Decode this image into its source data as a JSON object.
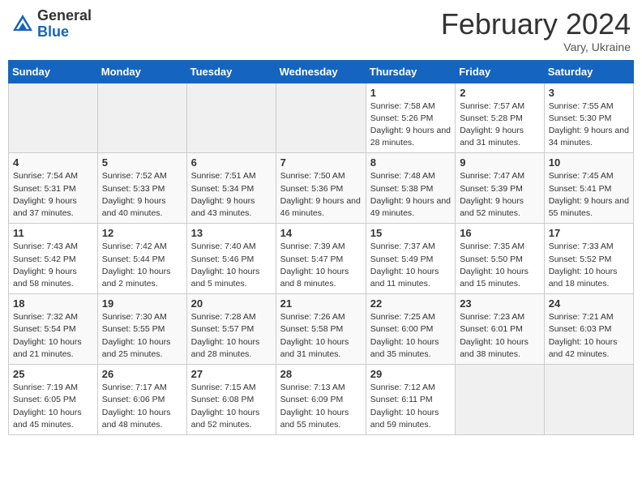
{
  "header": {
    "logo_general": "General",
    "logo_blue": "Blue",
    "title": "February 2024",
    "location": "Vary, Ukraine"
  },
  "columns": [
    "Sunday",
    "Monday",
    "Tuesday",
    "Wednesday",
    "Thursday",
    "Friday",
    "Saturday"
  ],
  "weeks": [
    [
      {
        "day": "",
        "info": ""
      },
      {
        "day": "",
        "info": ""
      },
      {
        "day": "",
        "info": ""
      },
      {
        "day": "",
        "info": ""
      },
      {
        "day": "1",
        "info": "Sunrise: 7:58 AM\nSunset: 5:26 PM\nDaylight: 9 hours\nand 28 minutes."
      },
      {
        "day": "2",
        "info": "Sunrise: 7:57 AM\nSunset: 5:28 PM\nDaylight: 9 hours\nand 31 minutes."
      },
      {
        "day": "3",
        "info": "Sunrise: 7:55 AM\nSunset: 5:30 PM\nDaylight: 9 hours\nand 34 minutes."
      }
    ],
    [
      {
        "day": "4",
        "info": "Sunrise: 7:54 AM\nSunset: 5:31 PM\nDaylight: 9 hours\nand 37 minutes."
      },
      {
        "day": "5",
        "info": "Sunrise: 7:52 AM\nSunset: 5:33 PM\nDaylight: 9 hours\nand 40 minutes."
      },
      {
        "day": "6",
        "info": "Sunrise: 7:51 AM\nSunset: 5:34 PM\nDaylight: 9 hours\nand 43 minutes."
      },
      {
        "day": "7",
        "info": "Sunrise: 7:50 AM\nSunset: 5:36 PM\nDaylight: 9 hours\nand 46 minutes."
      },
      {
        "day": "8",
        "info": "Sunrise: 7:48 AM\nSunset: 5:38 PM\nDaylight: 9 hours\nand 49 minutes."
      },
      {
        "day": "9",
        "info": "Sunrise: 7:47 AM\nSunset: 5:39 PM\nDaylight: 9 hours\nand 52 minutes."
      },
      {
        "day": "10",
        "info": "Sunrise: 7:45 AM\nSunset: 5:41 PM\nDaylight: 9 hours\nand 55 minutes."
      }
    ],
    [
      {
        "day": "11",
        "info": "Sunrise: 7:43 AM\nSunset: 5:42 PM\nDaylight: 9 hours\nand 58 minutes."
      },
      {
        "day": "12",
        "info": "Sunrise: 7:42 AM\nSunset: 5:44 PM\nDaylight: 10 hours\nand 2 minutes."
      },
      {
        "day": "13",
        "info": "Sunrise: 7:40 AM\nSunset: 5:46 PM\nDaylight: 10 hours\nand 5 minutes."
      },
      {
        "day": "14",
        "info": "Sunrise: 7:39 AM\nSunset: 5:47 PM\nDaylight: 10 hours\nand 8 minutes."
      },
      {
        "day": "15",
        "info": "Sunrise: 7:37 AM\nSunset: 5:49 PM\nDaylight: 10 hours\nand 11 minutes."
      },
      {
        "day": "16",
        "info": "Sunrise: 7:35 AM\nSunset: 5:50 PM\nDaylight: 10 hours\nand 15 minutes."
      },
      {
        "day": "17",
        "info": "Sunrise: 7:33 AM\nSunset: 5:52 PM\nDaylight: 10 hours\nand 18 minutes."
      }
    ],
    [
      {
        "day": "18",
        "info": "Sunrise: 7:32 AM\nSunset: 5:54 PM\nDaylight: 10 hours\nand 21 minutes."
      },
      {
        "day": "19",
        "info": "Sunrise: 7:30 AM\nSunset: 5:55 PM\nDaylight: 10 hours\nand 25 minutes."
      },
      {
        "day": "20",
        "info": "Sunrise: 7:28 AM\nSunset: 5:57 PM\nDaylight: 10 hours\nand 28 minutes."
      },
      {
        "day": "21",
        "info": "Sunrise: 7:26 AM\nSunset: 5:58 PM\nDaylight: 10 hours\nand 31 minutes."
      },
      {
        "day": "22",
        "info": "Sunrise: 7:25 AM\nSunset: 6:00 PM\nDaylight: 10 hours\nand 35 minutes."
      },
      {
        "day": "23",
        "info": "Sunrise: 7:23 AM\nSunset: 6:01 PM\nDaylight: 10 hours\nand 38 minutes."
      },
      {
        "day": "24",
        "info": "Sunrise: 7:21 AM\nSunset: 6:03 PM\nDaylight: 10 hours\nand 42 minutes."
      }
    ],
    [
      {
        "day": "25",
        "info": "Sunrise: 7:19 AM\nSunset: 6:05 PM\nDaylight: 10 hours\nand 45 minutes."
      },
      {
        "day": "26",
        "info": "Sunrise: 7:17 AM\nSunset: 6:06 PM\nDaylight: 10 hours\nand 48 minutes."
      },
      {
        "day": "27",
        "info": "Sunrise: 7:15 AM\nSunset: 6:08 PM\nDaylight: 10 hours\nand 52 minutes."
      },
      {
        "day": "28",
        "info": "Sunrise: 7:13 AM\nSunset: 6:09 PM\nDaylight: 10 hours\nand 55 minutes."
      },
      {
        "day": "29",
        "info": "Sunrise: 7:12 AM\nSunset: 6:11 PM\nDaylight: 10 hours\nand 59 minutes."
      },
      {
        "day": "",
        "info": ""
      },
      {
        "day": "",
        "info": ""
      }
    ]
  ]
}
